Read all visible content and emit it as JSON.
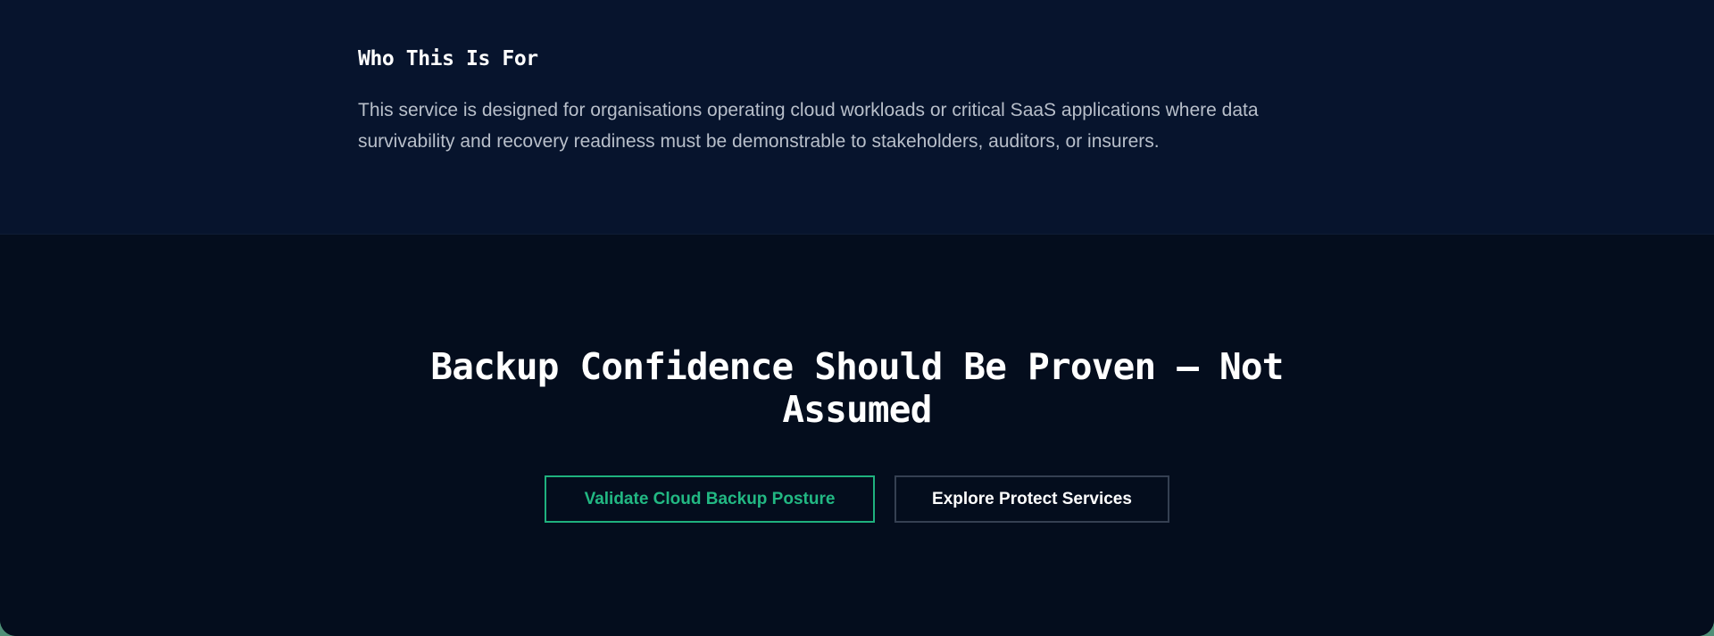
{
  "who_section": {
    "heading": "Who This Is For",
    "body": "This service is designed for organisations operating cloud workloads or critical SaaS applications where data survivability and recovery readiness must be demonstrable to stakeholders, auditors, or insurers."
  },
  "cta_section": {
    "title": "Backup Confidence Should Be Proven — Not Assumed",
    "primary_button": "Validate Cloud Backup Posture",
    "secondary_button": "Explore Protect Services"
  },
  "colors": {
    "upper_background": "#07142d",
    "lower_background": "#040d1d",
    "accent": "#22b883"
  }
}
